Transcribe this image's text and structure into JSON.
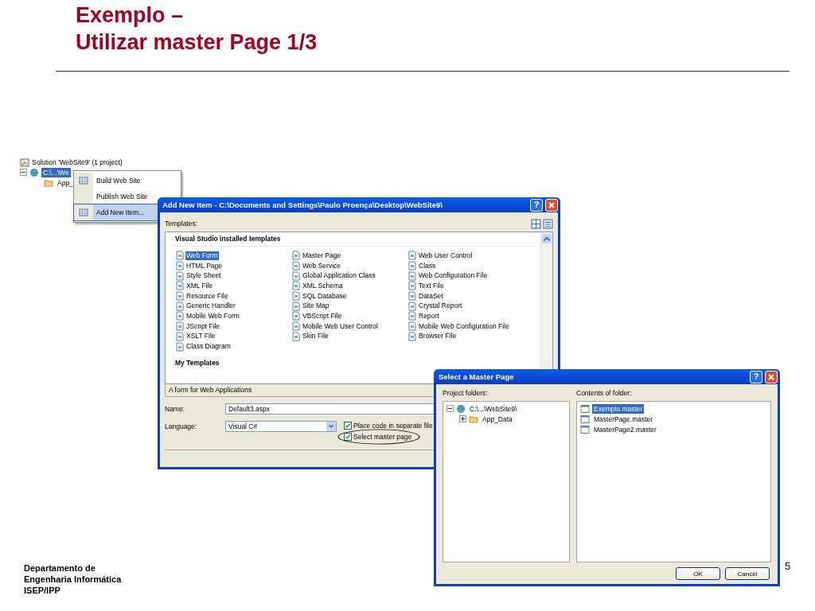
{
  "slide": {
    "title_lines": [
      "Exemplo –",
      "Utilizar master Page 1/3"
    ],
    "footer_lines": [
      "Departamento de",
      "Engenharia Informática",
      "ISEP/IPP"
    ],
    "page_number": "5"
  },
  "solution_explorer": {
    "root": "Solution 'WebSite9' (1 project)",
    "nodes": [
      {
        "label": "C:\\...\\We",
        "selected": true,
        "expanded": true,
        "children": [
          {
            "label": "App_",
            "selected": false
          }
        ]
      }
    ]
  },
  "context_menu": [
    {
      "label": "Build Web Site",
      "selected": false,
      "icon": true
    },
    {
      "label": "Publish Web Site",
      "selected": false,
      "icon": false
    },
    {
      "label": "Add New Item...",
      "selected": true,
      "icon": true
    }
  ],
  "add_new_item": {
    "title": "Add New Item - C:\\Documents and Settings\\Paulo Proença\\Desktop\\WebSite9\\",
    "help": "?",
    "templates_label": "Templates:",
    "group": "Visual Studio installed templates",
    "columns": [
      [
        {
          "label": "Web Form",
          "selected": true
        },
        {
          "label": "HTML Page",
          "selected": false
        },
        {
          "label": "Style Sheet",
          "selected": false
        },
        {
          "label": "XML File",
          "selected": false
        },
        {
          "label": "Resource File",
          "selected": false
        },
        {
          "label": "Generic Handler",
          "selected": false
        },
        {
          "label": "Mobile Web Form",
          "selected": false
        },
        {
          "label": "JScript File",
          "selected": false
        },
        {
          "label": "XSLT File",
          "selected": false
        },
        {
          "label": "Class Diagram",
          "selected": false
        }
      ],
      [
        {
          "label": "Master Page",
          "selected": false
        },
        {
          "label": "Web Service",
          "selected": false
        },
        {
          "label": "Global Application Class",
          "selected": false
        },
        {
          "label": "XML Schema",
          "selected": false
        },
        {
          "label": "SQL Database",
          "selected": false
        },
        {
          "label": "Site Map",
          "selected": false
        },
        {
          "label": "VBScript File",
          "selected": false
        },
        {
          "label": "Mobile Web User Control",
          "selected": false
        },
        {
          "label": "Skin File",
          "selected": false
        }
      ],
      [
        {
          "label": "Web User Control",
          "selected": false
        },
        {
          "label": "Class",
          "selected": false
        },
        {
          "label": "Web Configuration File",
          "selected": false
        },
        {
          "label": "Text File",
          "selected": false
        },
        {
          "label": "DataSet",
          "selected": false
        },
        {
          "label": "Crystal Report",
          "selected": false
        },
        {
          "label": "Report",
          "selected": false
        },
        {
          "label": "Mobile Web Configuration File",
          "selected": false
        },
        {
          "label": "Browser File",
          "selected": false
        }
      ]
    ],
    "my_templates": "My Templates",
    "description": "A form for Web Applications",
    "name_label": "Name:",
    "name_value": "Default3.aspx",
    "language_label": "Language:",
    "language_value": "Visual C#",
    "options": [
      {
        "label": "Place code in separate file",
        "checked": true,
        "circled": false
      },
      {
        "label": "Select master page",
        "checked": true,
        "circled": true
      }
    ]
  },
  "select_master": {
    "title": "Select a Master Page",
    "help": "?",
    "folders_label": "Project folders:",
    "contents_label": "Contents of folder:",
    "folders": [
      {
        "label": "C:\\...\\WebSite9\\",
        "expanded": true,
        "children": [
          {
            "label": "App_Data",
            "expanded": false
          }
        ]
      }
    ],
    "files": [
      {
        "label": "Exemplo.master",
        "selected": true
      },
      {
        "label": "MasterPage.master",
        "selected": false
      },
      {
        "label": "MasterPage2.master",
        "selected": false
      }
    ],
    "buttons": [
      "OK",
      "Cancel"
    ]
  }
}
